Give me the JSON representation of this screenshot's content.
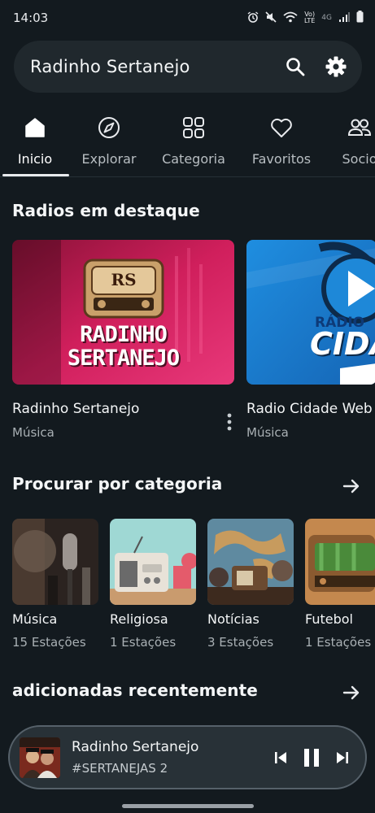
{
  "status_bar": {
    "time": "14:03",
    "network": "4G"
  },
  "search": {
    "title": "Radinho Sertanejo"
  },
  "tabs": [
    {
      "label": "Inicio",
      "icon": "home-icon"
    },
    {
      "label": "Explorar",
      "icon": "compass-icon"
    },
    {
      "label": "Categoria",
      "icon": "grid-icon"
    },
    {
      "label": "Favoritos",
      "icon": "heart-icon"
    },
    {
      "label": "Socio",
      "icon": "users-icon"
    }
  ],
  "featured": {
    "title": "Radios em destaque",
    "items": [
      {
        "name": "Radinho Sertanejo",
        "genre": "Música",
        "logo_line1": "RADINHO",
        "logo_line2": "SERTANEJO",
        "badge": "RS"
      },
      {
        "name": "Radio Cidade Web",
        "genre": "Música",
        "logo_line1": "RÁDIO",
        "logo_line2": "CIDADE"
      }
    ]
  },
  "categories": {
    "title": "Procurar por categoria",
    "items": [
      {
        "name": "Música",
        "count": "15 Estações"
      },
      {
        "name": "Religiosa",
        "count": "1 Estações"
      },
      {
        "name": "Notícias",
        "count": "3 Estações"
      },
      {
        "name": "Futebol",
        "count": "1 Estações"
      }
    ]
  },
  "recent": {
    "title": "adicionadas recentemente"
  },
  "player": {
    "title": "Radinho Sertanejo",
    "subtitle": "#SERTANEJAS 2",
    "state": "playing"
  },
  "colors": {
    "background": "#131a1f",
    "surface": "#20282d",
    "player_border": "#56616a",
    "featured_pink": "#d01f5c",
    "featured_blue": "#1f8ee0"
  }
}
